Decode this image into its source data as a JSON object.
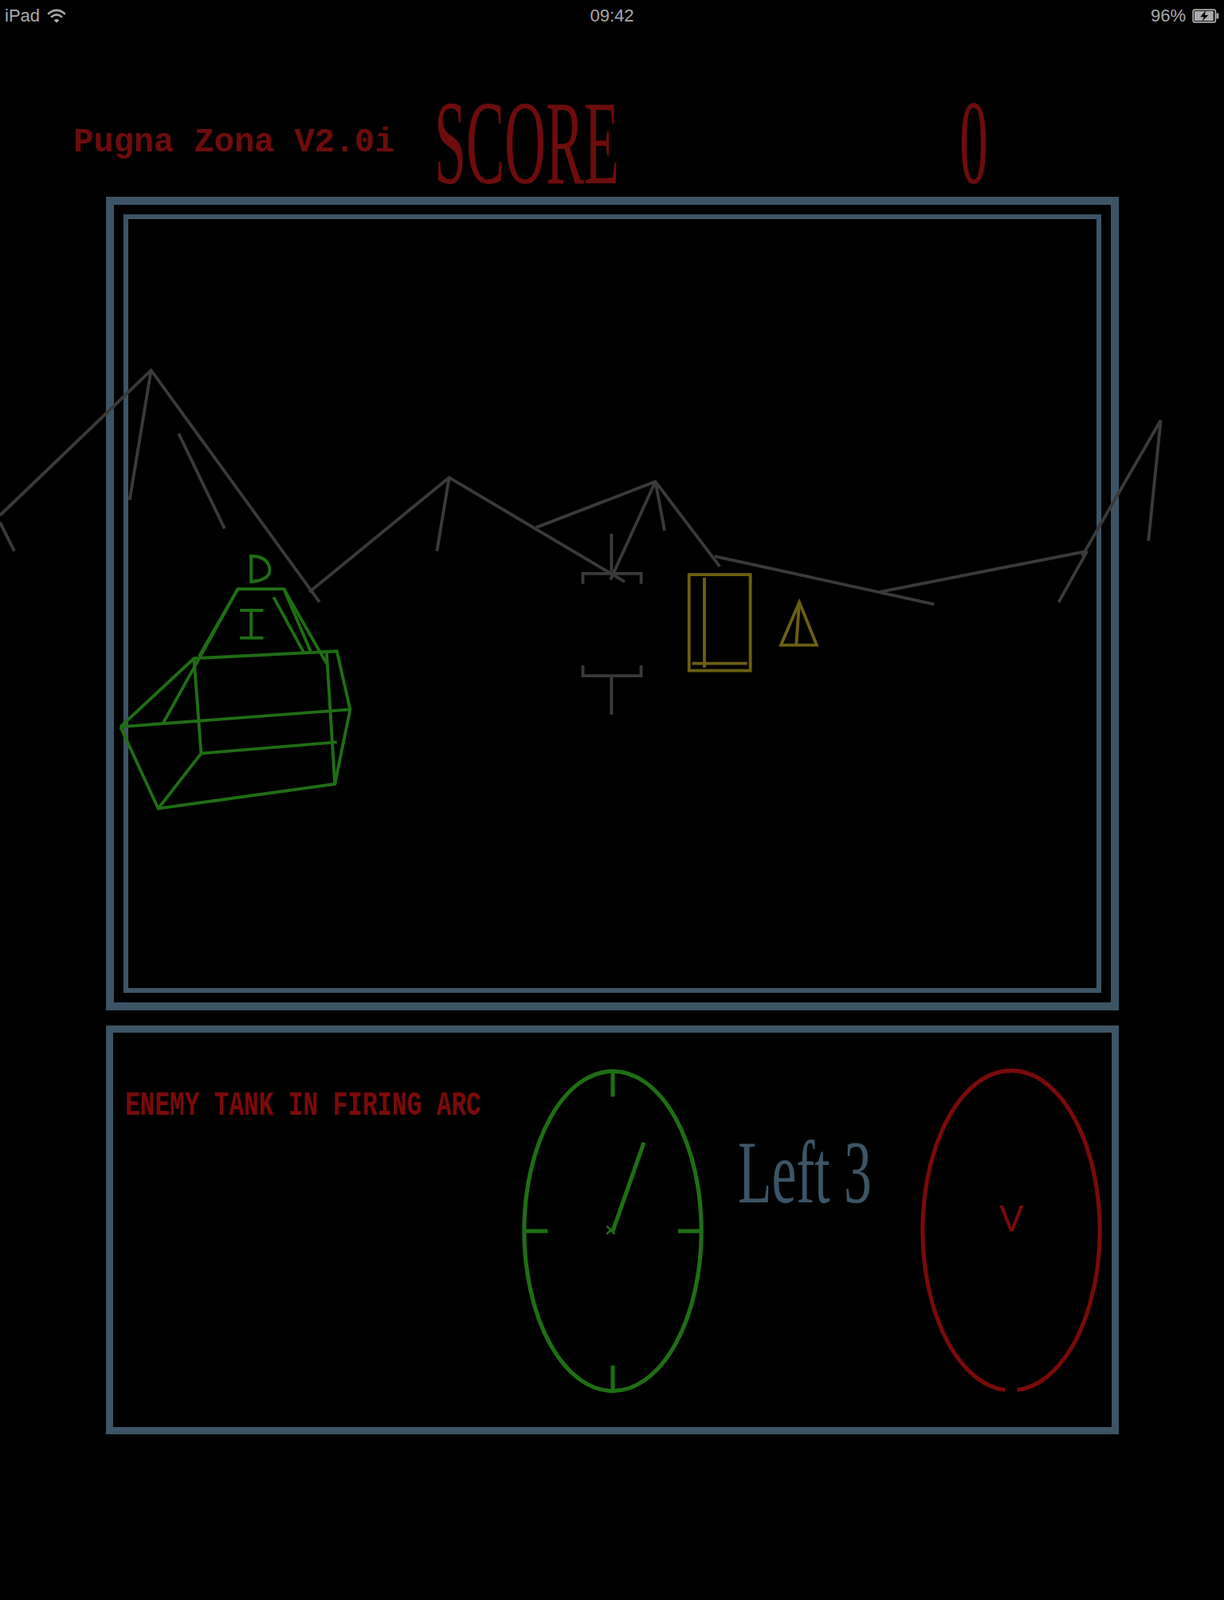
{
  "status_bar": {
    "device": "iPad",
    "time": "09:42",
    "battery": {
      "text": "96%",
      "level": 0.96,
      "charging": true
    }
  },
  "header": {
    "title": "Pugna Zona V2.0i",
    "score_label": "SCORE",
    "score": "0"
  },
  "console": {
    "message": "ENEMY TANK IN FIRING ARC",
    "lives": "Left 3",
    "compass": {
      "level": 0.09
    },
    "radar": {
      "marker": "V"
    }
  }
}
